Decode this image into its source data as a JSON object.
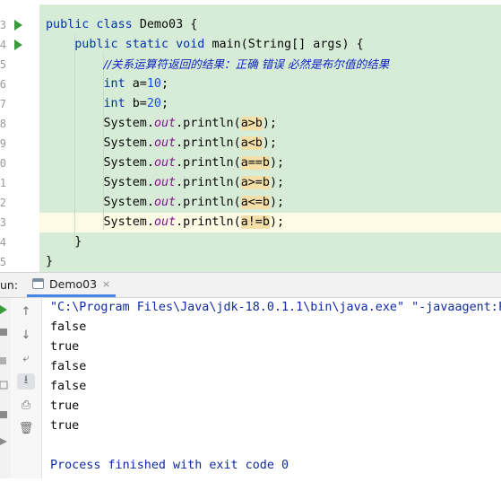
{
  "editor": {
    "lines": [
      {
        "num": "3",
        "run": true
      },
      {
        "num": "4",
        "run": true
      },
      {
        "num": "5",
        "run": false
      },
      {
        "num": "6",
        "run": false
      },
      {
        "num": "7",
        "run": false
      },
      {
        "num": "8",
        "run": false
      },
      {
        "num": "9",
        "run": false
      },
      {
        "num": "0",
        "run": false
      },
      {
        "num": "1",
        "run": false
      },
      {
        "num": "2",
        "run": false
      },
      {
        "num": "3",
        "run": false
      },
      {
        "num": "4",
        "run": false
      },
      {
        "num": "5",
        "run": false
      }
    ],
    "code": {
      "l1_kw": "public class ",
      "l1_rest": "Demo03 {",
      "l2_kw": "public static void ",
      "l2_rest": "main(String[] args) {",
      "l3_comment": "//关系运算符返回的结果：正确 错误 必然是布尔值的结果",
      "l4_kw": "int ",
      "l4_a": "a=",
      "l4_num": "10",
      "l4_end": ";",
      "l5_kw": "int ",
      "l5_b": "b=",
      "l5_num": "20",
      "l5_end": ";",
      "sys": "System.",
      "out": "out",
      "println": ".println(",
      "p1": "a>b",
      "p2": "a<b",
      "p3": "a==b",
      "p4": "a>=b",
      "p5": "a<=b",
      "p6": "a!=b",
      "close": ");",
      "brace": "}"
    }
  },
  "run_panel": {
    "label": "un:",
    "tab": "Demo03",
    "tab_close": "×",
    "command": "\"C:\\Program Files\\Java\\jdk-18.0.1.1\\bin\\java.exe\" \"-javaagent:F",
    "output": [
      "false",
      "true",
      "false",
      "false",
      "true",
      "true"
    ],
    "finished": "Process finished with exit code 0"
  },
  "colors": {
    "code_background": "#d6ecd6",
    "keyword": "#0033b3",
    "number": "#1750eb",
    "field": "#871094",
    "highlight": "#f4dfa8",
    "run_arrow": "#3c9b3c"
  }
}
